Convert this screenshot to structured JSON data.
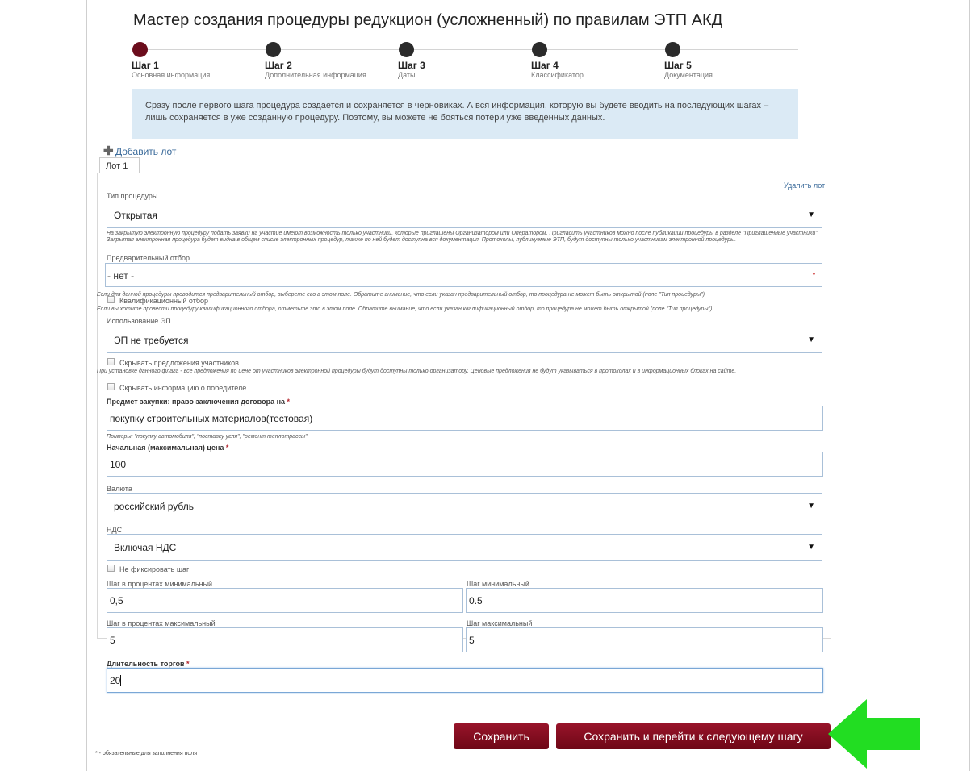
{
  "wizard": {
    "title": "Мастер создания процедуры редукцион (усложненный) по правилам ЭТП АКД",
    "steps": [
      {
        "name": "Шаг 1",
        "desc": "Основная информация"
      },
      {
        "name": "Шаг 2",
        "desc": "Дополнительная информация"
      },
      {
        "name": "Шаг 3",
        "desc": "Даты"
      },
      {
        "name": "Шаг 4",
        "desc": "Классификатор"
      },
      {
        "name": "Шаг 5",
        "desc": "Документация"
      }
    ],
    "active_step": 1,
    "info_text": "Сразу после первого шага процедура создается и сохраняется в черновиках. А вся информация, которую вы будете вводить на последующих шагах – лишь сохраняется в уже созданную процедуру. Поэтому, вы можете не бояться потери уже введенных данных."
  },
  "lots": {
    "add_label": "Добавить лот",
    "tab_label": "Лот 1",
    "delete_label": "Удалить лот"
  },
  "form": {
    "procedure_type": {
      "label": "Тип процедуры",
      "value": "Открытая",
      "hint": "На закрытую электронную процедуру подать заявки на участие имеют возможность только участники, которые приглашены Организатором или Оператором. Пригласить участников можно после публикации процедуры в разделе \"Приглашенные участники\". Закрытая электронная процедура будет видна в общем списке электронных процедур, также по ней будет доступна вся документация. Протоколы, публикуемые ЭТП, будут доступны только участникам электронной процедуры."
    },
    "preselection": {
      "label": "Предварительный отбор",
      "value": "- нет -",
      "hint": "Если для данной процедуры проводится предварительный отбор, выберете его в этом поле. Обратите внимание, что если указан предварительный отбор, то процедура не может быть открытой (поле \"Тип процедуры\")"
    },
    "qualification": {
      "label": "Квалификационный отбор",
      "checked": false,
      "hint": "Если вы хотите провести процедуру квалификационного отбора, отметьте это в этом поле. Обратите внимание, что если указан квалификационный отбор, то процедура не может быть открытой (поле \"Тип процедуры\")"
    },
    "signature": {
      "label": "Использование ЭП",
      "value": "ЭП не требуется"
    },
    "hide_offers": {
      "label": "Скрывать предложения участников",
      "checked": false,
      "hint": "При установке данного флага - все предложения по цене от участников электронной процедуры будут доступны только организатору. Ценовые предложения не будут указываться в протоколах и в информационных блоках на сайте."
    },
    "hide_winner": {
      "label": "Скрывать информацию о победителе",
      "checked": false
    },
    "subject": {
      "label": "Предмет закупки: право заключения договора на",
      "required_mark": "*",
      "value": "покупку строительных материалов(тестовая)",
      "hint": "Примеры: \"покупку автомобиля\", \"поставку угля\", \"ремонт теплотрассы\""
    },
    "start_price": {
      "label": "Начальная (максимальная) цена",
      "required_mark": "*",
      "value": "100"
    },
    "currency": {
      "label": "Валюта",
      "value": "российский рубль"
    },
    "vat": {
      "label": "НДС",
      "value": "Включая НДС"
    },
    "fix_step": {
      "label": "Не фиксировать шаг",
      "checked": false
    },
    "step_pct_min": {
      "label": "Шаг в процентах минимальный",
      "value": "0,5"
    },
    "step_min": {
      "label": "Шаг минимальный",
      "value": "0.5"
    },
    "step_pct_max": {
      "label": "Шаг в процентах максимальный",
      "value": "5"
    },
    "step_max": {
      "label": "Шаг максимальный",
      "value": "5"
    },
    "duration": {
      "label": "Длительность торгов",
      "required_mark": "*",
      "value": "20"
    }
  },
  "actions": {
    "save_label": "Сохранить",
    "save_next_label": "Сохранить и перейти к следующему шагу"
  },
  "footer": {
    "required_note": "* - обязательные для заполнения поля"
  },
  "colors": {
    "accent": "#7e0b1d",
    "info_bg": "#dbeaf5",
    "arrow": "#22dd22",
    "link": "#3a6a9a"
  }
}
